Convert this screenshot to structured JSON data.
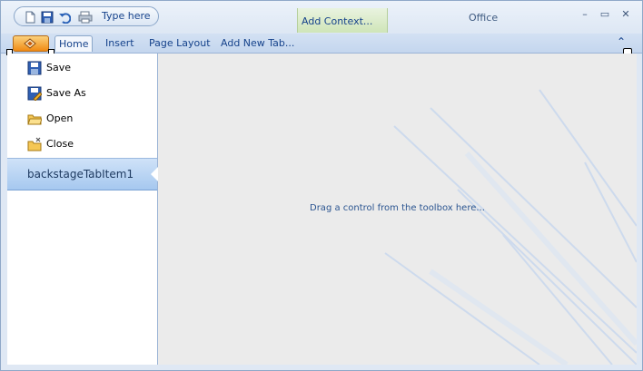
{
  "quick_access": {
    "items": [
      {
        "name": "new-icon"
      },
      {
        "name": "save-icon"
      },
      {
        "name": "undo-icon"
      },
      {
        "name": "print-icon"
      }
    ],
    "label": "Type here"
  },
  "contextual_tab": {
    "label": "Add Context..."
  },
  "window": {
    "title": "Office",
    "minimize_glyph": "–",
    "maximize_glyph": "▭",
    "close_glyph": "✕"
  },
  "ribbon": {
    "tabs": [
      {
        "label": "Home",
        "selected": true
      },
      {
        "label": "Insert",
        "selected": false
      },
      {
        "label": "Page Layout",
        "selected": false
      },
      {
        "label": "Add New Tab...",
        "selected": false
      }
    ],
    "collapse_glyph": "⌃"
  },
  "backstage": {
    "menu": [
      {
        "label": "Save",
        "icon": "save-icon"
      },
      {
        "label": "Save As",
        "icon": "save-as-icon"
      },
      {
        "label": "Open",
        "icon": "open-folder-icon"
      },
      {
        "label": "Close",
        "icon": "close-folder-icon"
      }
    ],
    "tab_item": {
      "label": "backstageTabItem1"
    },
    "content_hint": "Drag a control from the toolbox here..."
  },
  "colors": {
    "accent": "#15428b",
    "app_button": "#f08a13",
    "selected_tab": "#a6c8ef",
    "context_tab": "#cfe5b8"
  }
}
